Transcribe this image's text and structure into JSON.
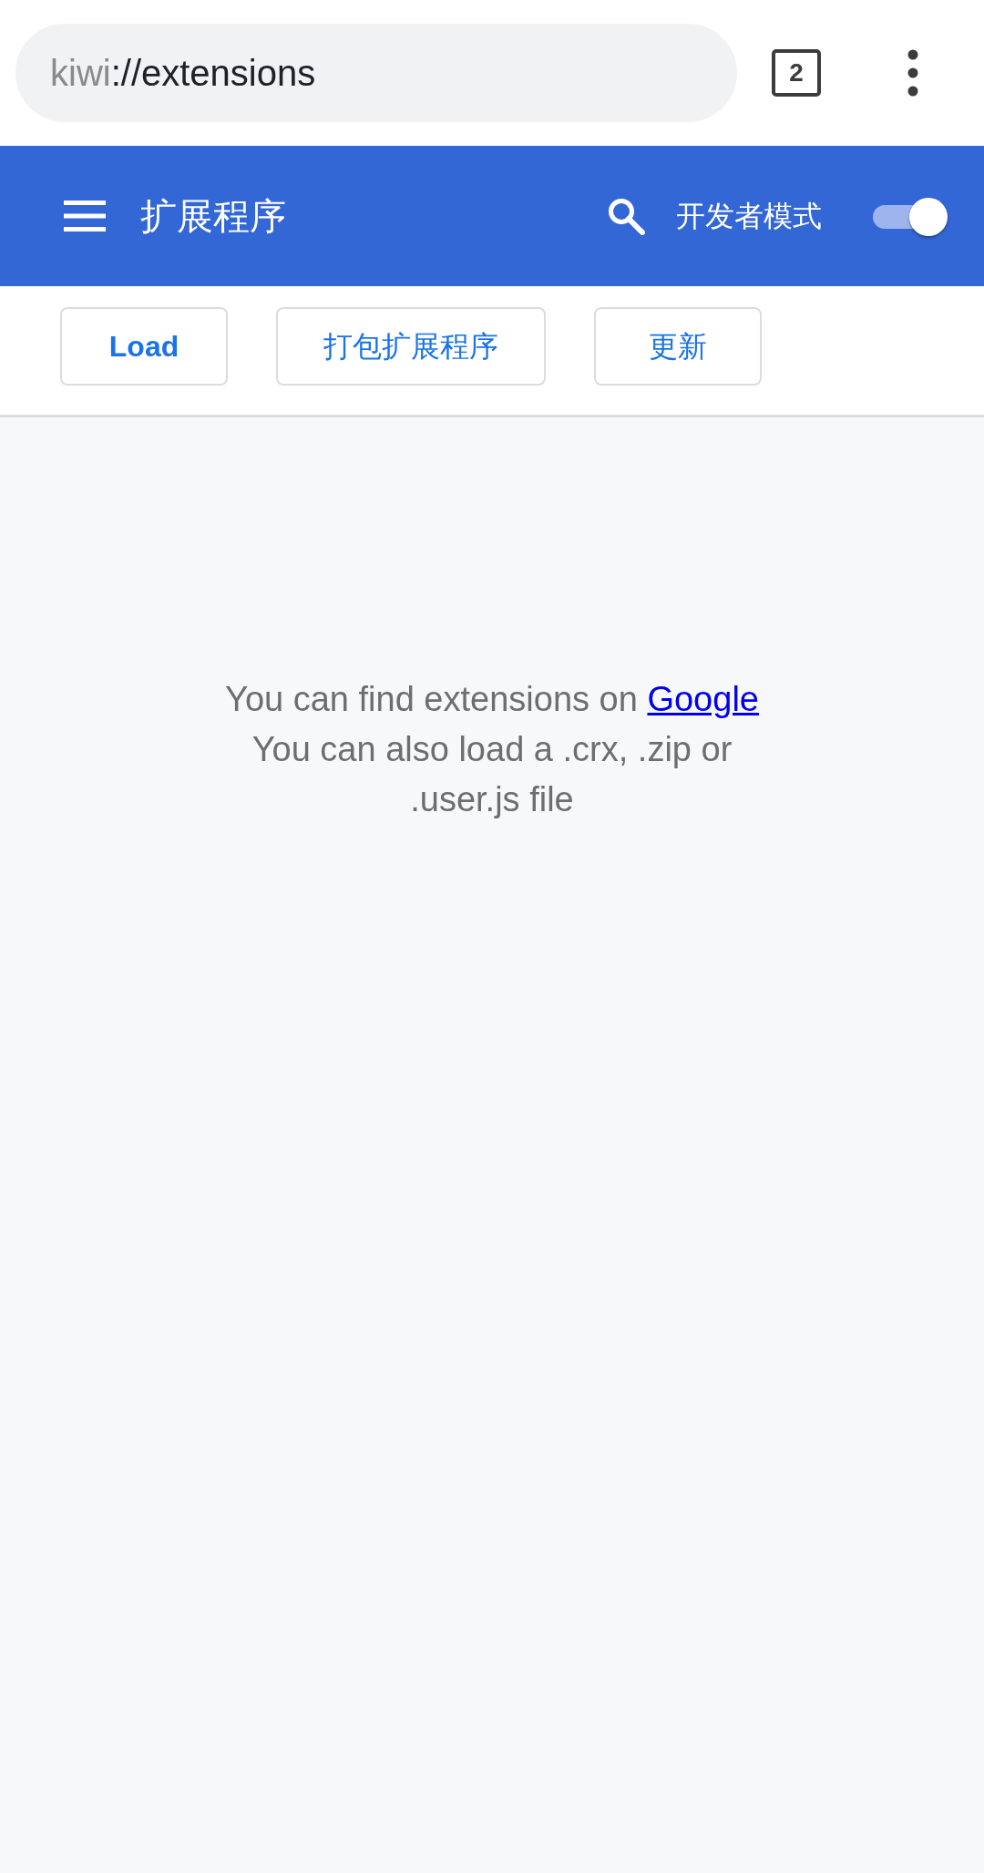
{
  "browser": {
    "address": {
      "scheme": "kiwi",
      "path": "://extensions"
    },
    "tab_count": "2"
  },
  "header": {
    "title": "扩展程序",
    "developer_mode": {
      "label": "开发者模式",
      "on": true
    }
  },
  "toolbar": {
    "buttons": [
      {
        "label": "Load",
        "bold": true
      },
      {
        "label": "打包扩展程序",
        "bold": false
      },
      {
        "label": "更新",
        "bold": false
      }
    ]
  },
  "empty_state": {
    "text": "You can find extensions on",
    "link": "Google",
    "hint": "You can also load a .crx, .zip or .user.js file"
  }
}
